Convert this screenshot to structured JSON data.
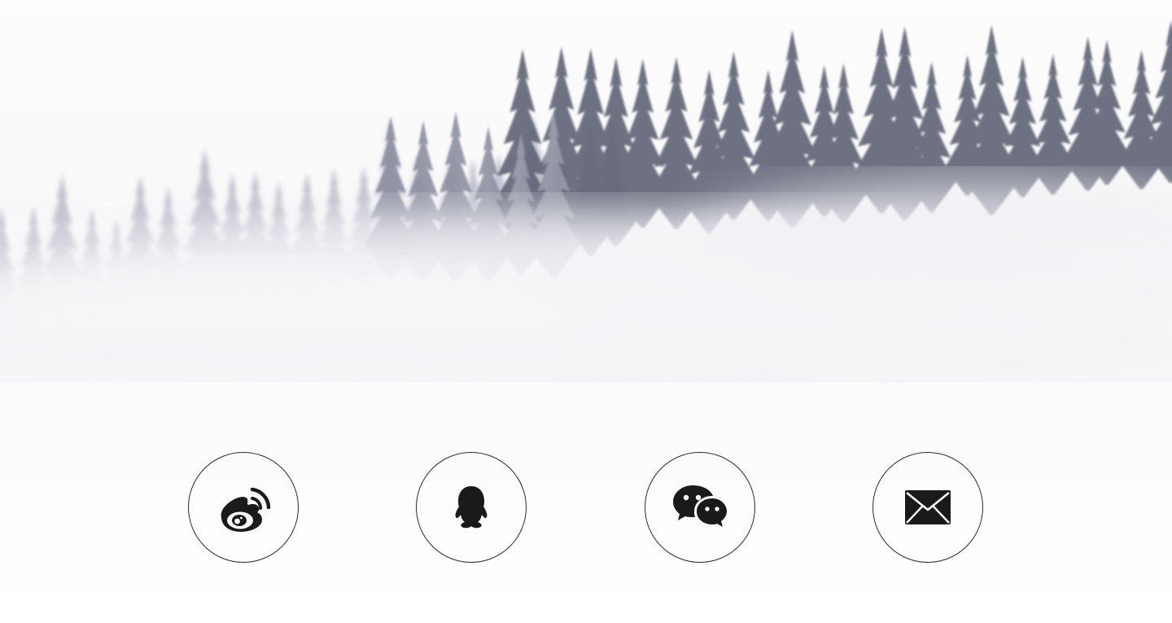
{
  "background": {
    "scene": "misty-pine-forest",
    "colors": {
      "sky": "#fbfbfc",
      "mist": "#eeeef3",
      "tree_far": "#b7b8c6",
      "tree_near": "#5f6375"
    }
  },
  "social_buttons": [
    {
      "id": "weibo",
      "icon": "weibo-icon"
    },
    {
      "id": "qq",
      "icon": "qq-icon"
    },
    {
      "id": "wechat",
      "icon": "wechat-icon"
    },
    {
      "id": "email",
      "icon": "email-icon"
    }
  ],
  "colors": {
    "icon": "#1a1a1a",
    "ring": "#2b2b2b"
  }
}
